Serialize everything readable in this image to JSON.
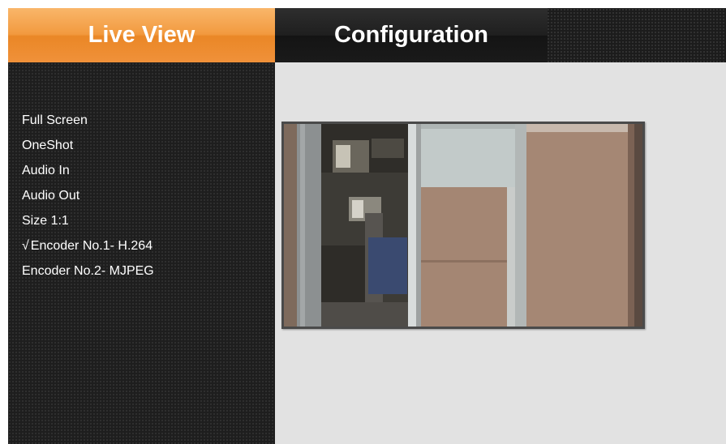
{
  "tabs": {
    "live_view": "Live View",
    "configuration": "Configuration"
  },
  "sidebar": {
    "items": [
      {
        "label": "Full Screen"
      },
      {
        "label": "OneShot"
      },
      {
        "label": "Audio In"
      },
      {
        "label": "Audio Out"
      },
      {
        "label": "Size 1:1"
      },
      {
        "check": "√",
        "label": "Encoder No.1- H.264"
      },
      {
        "label": "Encoder No.2- MJPEG"
      }
    ]
  },
  "colors": {
    "active_tab": "#f0913a",
    "tab_bar": "#1c1c1c",
    "sidebar": "#1e1e1e",
    "main_background": "#e2e2e2"
  }
}
